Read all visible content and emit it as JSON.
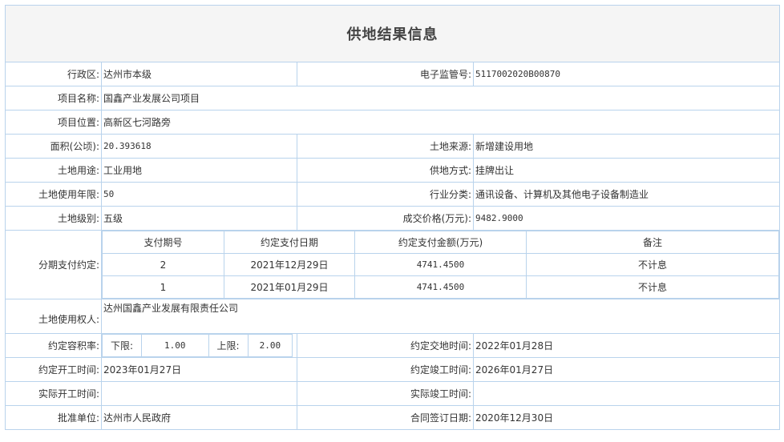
{
  "title": "供地结果信息",
  "fields": {
    "district": {
      "label": "行政区:",
      "value": "达州市本级"
    },
    "supervision_no": {
      "label": "电子监管号:",
      "value": "5117002020B00870"
    },
    "project_name": {
      "label": "项目名称:",
      "value": "国鑫产业发展公司项目"
    },
    "project_location": {
      "label": "项目位置:",
      "value": "高新区七河路旁"
    },
    "area": {
      "label": "面积(公顷):",
      "value": "20.393618"
    },
    "land_source": {
      "label": "土地来源:",
      "value": "新增建设用地"
    },
    "land_use": {
      "label": "土地用途:",
      "value": "工业用地"
    },
    "supply_method": {
      "label": "供地方式:",
      "value": "挂牌出让"
    },
    "use_years": {
      "label": "土地使用年限:",
      "value": "50"
    },
    "industry": {
      "label": "行业分类:",
      "value": "通讯设备、计算机及其他电子设备制造业"
    },
    "land_grade": {
      "label": "土地级别:",
      "value": "五级"
    },
    "deal_price": {
      "label": "成交价格(万元):",
      "value": "9482.9000"
    },
    "installment_label": "分期支付约定:",
    "land_user": {
      "label": "土地使用权人:",
      "value": "达州国鑫产业发展有限责任公司"
    },
    "plot_ratio": {
      "label": "约定容积率:",
      "lower_label": "下限:",
      "lower_value": "1.00",
      "upper_label": "上限:",
      "upper_value": "2.00"
    },
    "delivery_time": {
      "label": "约定交地时间:",
      "value": "2022年01月28日"
    },
    "start_time": {
      "label": "约定开工时间:",
      "value": "2023年01月27日"
    },
    "completion_time": {
      "label": "约定竣工时间:",
      "value": "2026年01月27日"
    },
    "actual_start": {
      "label": "实际开工时间:",
      "value": ""
    },
    "actual_completion": {
      "label": "实际竣工时间:",
      "value": ""
    },
    "approval_unit": {
      "label": "批准单位:",
      "value": "达州市人民政府"
    },
    "contract_date": {
      "label": "合同签订日期:",
      "value": "2020年12月30日"
    }
  },
  "installments": {
    "headers": [
      "支付期号",
      "约定支付日期",
      "约定支付金额(万元)",
      "备注"
    ],
    "rows": [
      [
        "2",
        "2021年12月29日",
        "4741.4500",
        "不计息"
      ],
      [
        "1",
        "2021年01月29日",
        "4741.4500",
        "不计息"
      ]
    ]
  }
}
